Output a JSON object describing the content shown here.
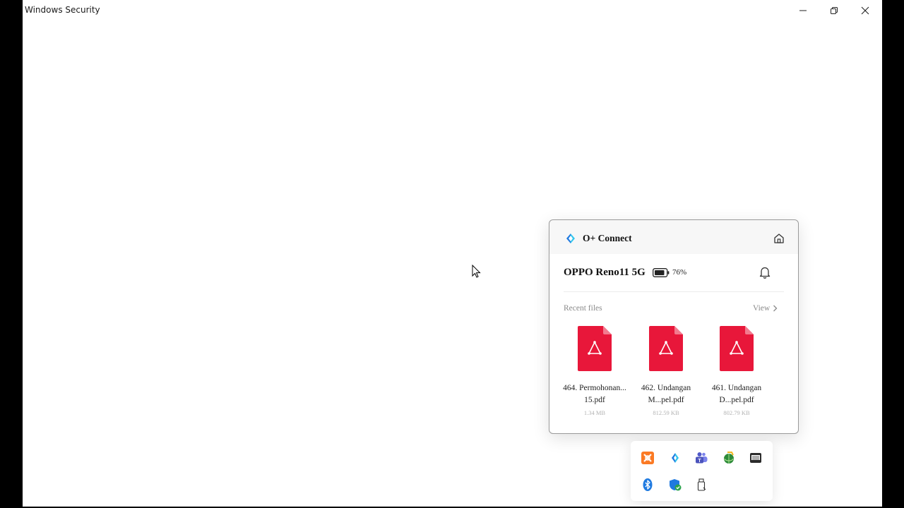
{
  "window": {
    "title": "Windows Security"
  },
  "flyout": {
    "app_name": "O+ Connect",
    "device_name": "OPPO Reno11 5G",
    "battery": "76%",
    "recent_label": "Recent files",
    "view_label": "View",
    "files": [
      {
        "name": "464. Permohonan... 15.pdf",
        "size": "1.34 MB"
      },
      {
        "name": "462. Undangan M...pel.pdf",
        "size": "812.59 KB"
      },
      {
        "name": "461. Undangan D...pel.pdf",
        "size": "802.79 KB"
      }
    ]
  },
  "tray": {
    "icons": [
      "xampp-icon",
      "o-plus-connect-icon",
      "teams-icon",
      "network-globe-icon",
      "keyboard-icon",
      "bluetooth-icon",
      "windows-security-icon",
      "usb-drive-icon"
    ]
  },
  "colors": {
    "pdf_red": "#e8173a",
    "accent_blue": "#1f7ae0"
  }
}
